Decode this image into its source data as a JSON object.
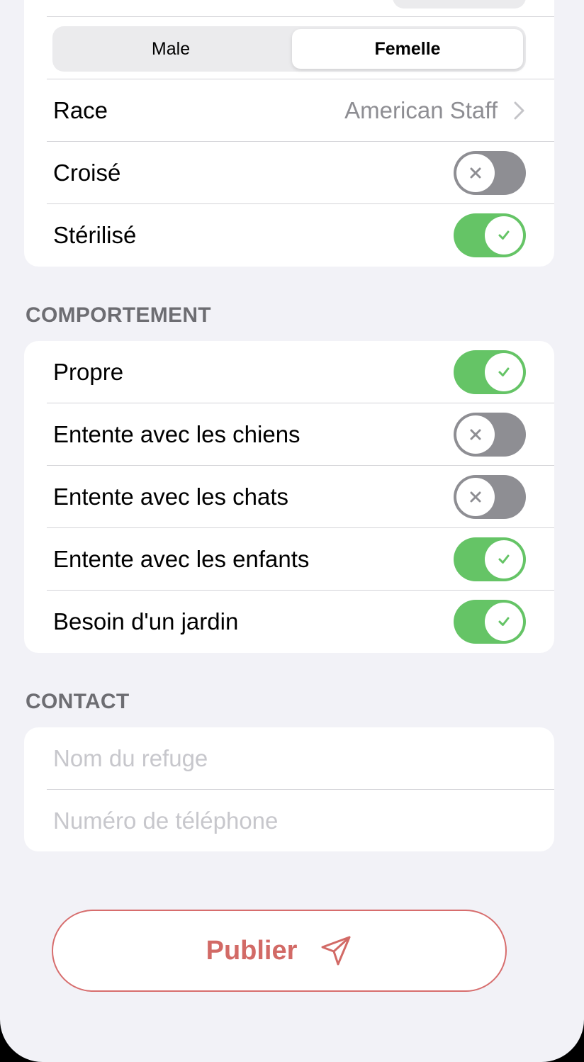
{
  "animal": {
    "gender": {
      "options": [
        "Male",
        "Femelle"
      ],
      "selected": "Femelle"
    },
    "breed": {
      "label": "Race",
      "value": "American Staff"
    },
    "crossbreed": {
      "label": "Croisé",
      "on": false
    },
    "sterilized": {
      "label": "Stérilisé",
      "on": true
    }
  },
  "behavior": {
    "title": "COMPORTEMENT",
    "items": [
      {
        "label": "Propre",
        "on": true
      },
      {
        "label": "Entente avec les chiens",
        "on": false
      },
      {
        "label": "Entente avec les chats",
        "on": false
      },
      {
        "label": "Entente avec les enfants",
        "on": true
      },
      {
        "label": "Besoin d'un jardin",
        "on": true
      }
    ]
  },
  "contact": {
    "title": "CONTACT",
    "shelter_placeholder": "Nom du refuge",
    "phone_placeholder": "Numéro de téléphone"
  },
  "publish": {
    "label": "Publier",
    "icon": "paper-plane-icon"
  },
  "colors": {
    "accent": "#d26a66",
    "toggle_on": "#65c466",
    "toggle_off": "#8e8e93",
    "background": "#f2f2f7"
  }
}
